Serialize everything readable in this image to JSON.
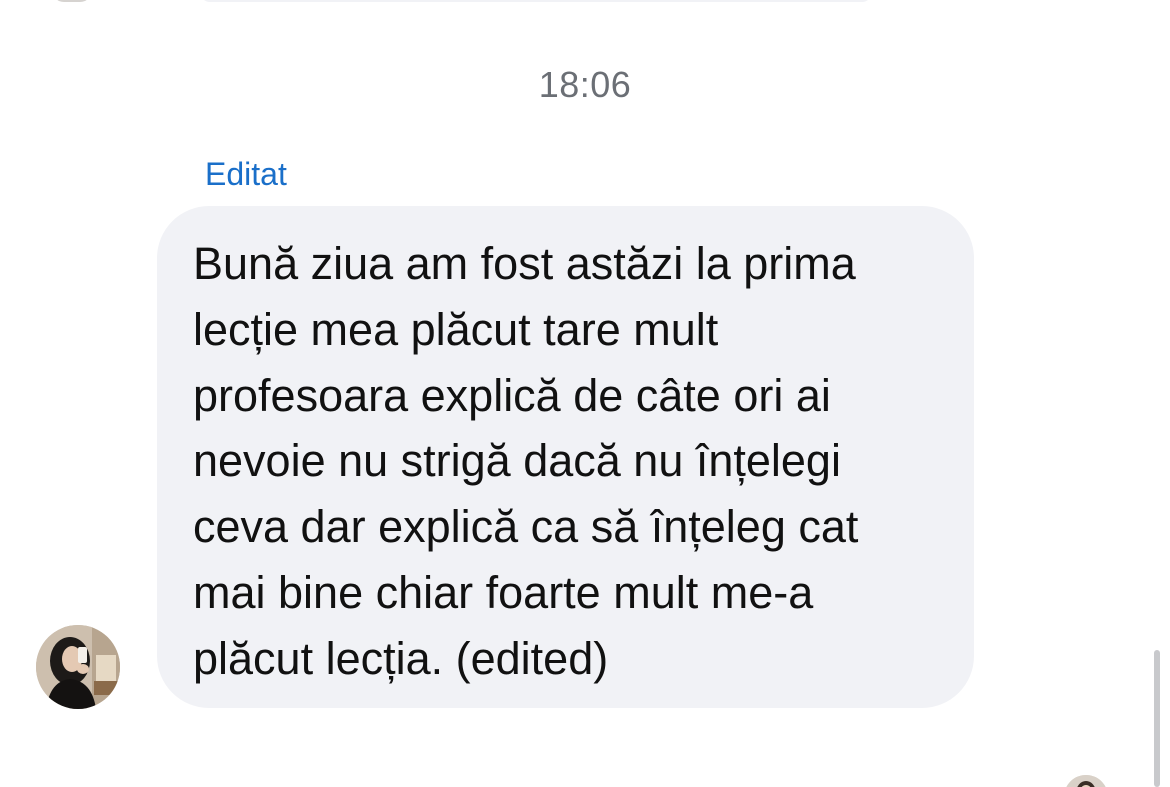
{
  "conversation": {
    "timestamp": "18:06",
    "message": {
      "edited_label": "Editat",
      "text": "Bună ziua am fost astăzi la prima\nlecție mea plăcut tare mult\nprofesoara explică de câte ori ai\nnevoie nu strigă dacă nu înțelegi\nceva dar explică ca să înțeleg cat\nmai bine chiar foarte mult me-a\nplăcut lecția. (edited)",
      "bubble_color": "#f1f2f6",
      "edited_label_color": "#1a6fc9"
    }
  },
  "icons": {
    "sender_avatar": "avatar-photo",
    "next_sender_avatar": "avatar-photo"
  }
}
